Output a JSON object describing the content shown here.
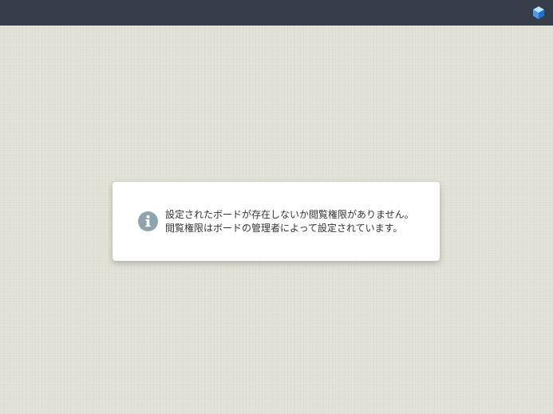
{
  "topbar": {
    "logo_icon": "cube-logo-icon",
    "bg_color": "#363c48"
  },
  "dialog": {
    "icon": "info-icon",
    "icon_color": "#8fa3ae",
    "line1": "設定されたボードが存在しないか閲覧権限がありません。",
    "line2": "閲覧権限はボードの管理者によって設定されています。"
  }
}
